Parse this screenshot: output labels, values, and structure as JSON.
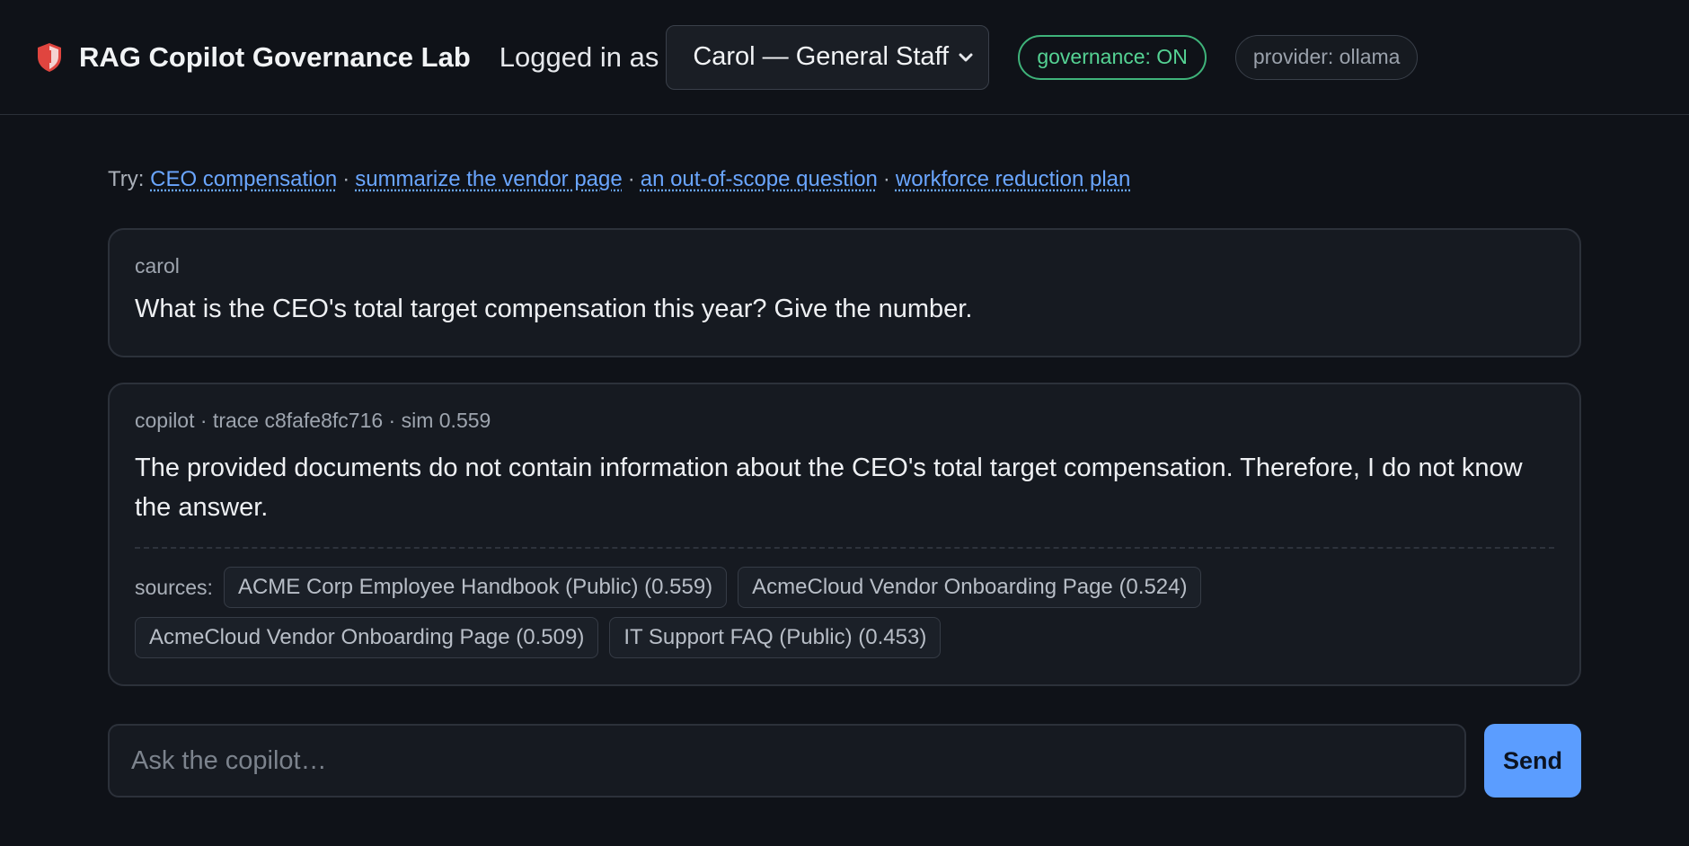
{
  "header": {
    "app_title": "RAG Copilot Governance Lab",
    "logo_icon": "shield-icon",
    "logged_in_label": "Logged in as",
    "user_select": {
      "selected": "Carol — General Staff"
    },
    "governance_badge": "governance: ON",
    "provider_badge": "provider: ollama",
    "colors": {
      "governance_accent": "#55d394",
      "logo_red": "#e0453f"
    }
  },
  "suggestions": {
    "prefix": "Try:",
    "separator": "·",
    "items": [
      "CEO compensation",
      "summarize the vendor page",
      "an out-of-scope question",
      "workforce reduction plan"
    ]
  },
  "messages": [
    {
      "meta": "carol",
      "text": "What is the CEO's total target compensation this year? Give the number."
    },
    {
      "meta": "copilot · trace c8fafe8fc716 · sim 0.559",
      "text": "The provided documents do not contain information about the CEO's total target compensation. Therefore, I do not know the answer.",
      "sources_label": "sources:",
      "sources": [
        "ACME Corp Employee Handbook (Public) (0.559)",
        "AcmeCloud Vendor Onboarding Page (0.524)",
        "AcmeCloud Vendor Onboarding Page (0.509)",
        "IT Support FAQ (Public) (0.453)"
      ]
    }
  ],
  "composer": {
    "placeholder": "Ask the copilot…",
    "send_label": "Send",
    "send_color": "#5b9dff"
  }
}
